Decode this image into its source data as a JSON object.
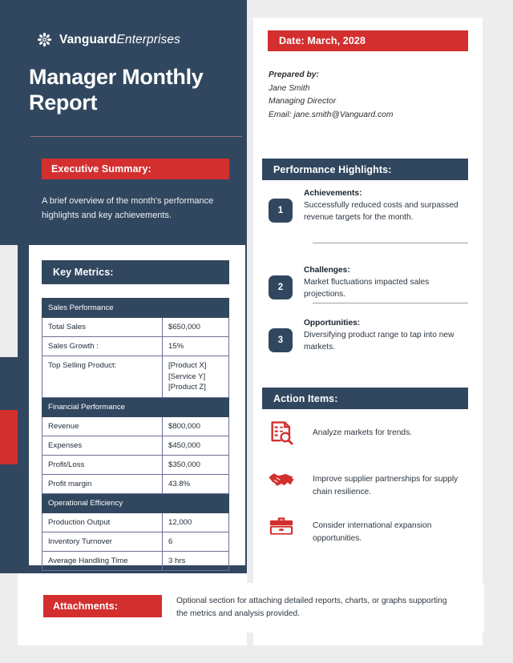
{
  "brand": {
    "name_bold": "Vanguard",
    "name_italic": "Enterprises",
    "logo_icon": "rosette-logo-icon"
  },
  "header": {
    "title": "Manager Monthly Report",
    "date_label": "Date: March, 2028"
  },
  "prepared": {
    "label": "Prepared by:",
    "name": "Jane Smith",
    "role": "Managing Director",
    "email": "Email: jane.smith@Vanguard.com"
  },
  "executive_summary": {
    "heading": "Executive Summary:",
    "body": "A brief overview of the month's performance highlights and key achievements."
  },
  "key_metrics": {
    "heading": "Key Metrics:",
    "rows": [
      {
        "type": "section",
        "label": "Sales Performance",
        "value": ""
      },
      {
        "type": "row",
        "label": "Total Sales",
        "value": "$650,000"
      },
      {
        "type": "row",
        "label": "Sales Growth :",
        "value": "15%"
      },
      {
        "type": "row",
        "label": "Top Selling Product:",
        "value": "[Product X]\n[Service Y]\n[Product Z]"
      },
      {
        "type": "section",
        "label": "Financial Performance",
        "value": ""
      },
      {
        "type": "row",
        "label": "Revenue",
        "value": "$800,000"
      },
      {
        "type": "row",
        "label": "Expenses",
        "value": "$450,000"
      },
      {
        "type": "row",
        "label": "Profit/Loss",
        "value": "$350,000"
      },
      {
        "type": "row",
        "label": "Profit margin",
        "value": "43.8%"
      },
      {
        "type": "section",
        "label": "Operational Efficiency",
        "value": ""
      },
      {
        "type": "row",
        "label": "Production Output",
        "value": "12,000"
      },
      {
        "type": "row",
        "label": "Inventory Turnover",
        "value": "6"
      },
      {
        "type": "row",
        "label": "Average Handling Time",
        "value": "3 hrs"
      }
    ]
  },
  "performance_highlights": {
    "heading": "Performance Highlights:",
    "items": [
      {
        "number": "1",
        "title": "Achievements:",
        "text": "Successfully reduced costs and surpassed revenue targets for the month."
      },
      {
        "number": "2",
        "title": "Challenges:",
        "text": "Market fluctuations impacted sales projections."
      },
      {
        "number": "3",
        "title": "Opportunities:",
        "text": "Diversifying product range to tap into new markets."
      }
    ]
  },
  "action_items": {
    "heading": "Action Items:",
    "items": [
      {
        "icon": "document-search-icon",
        "text": "Analyze markets for trends."
      },
      {
        "icon": "handshake-icon",
        "text": "Improve supplier partnerships for supply chain resilience."
      },
      {
        "icon": "briefcase-icon",
        "text": "Consider international expansion opportunities."
      }
    ]
  },
  "attachments": {
    "heading": "Attachments:",
    "text": "Optional section for attaching detailed reports, charts, or graphs supporting the metrics and analysis provided."
  },
  "colors": {
    "navy": "#31475f",
    "red": "#d32f2f",
    "page_bg": "#ededed",
    "card": "#ffffff",
    "table_border": "#6d6f98"
  }
}
